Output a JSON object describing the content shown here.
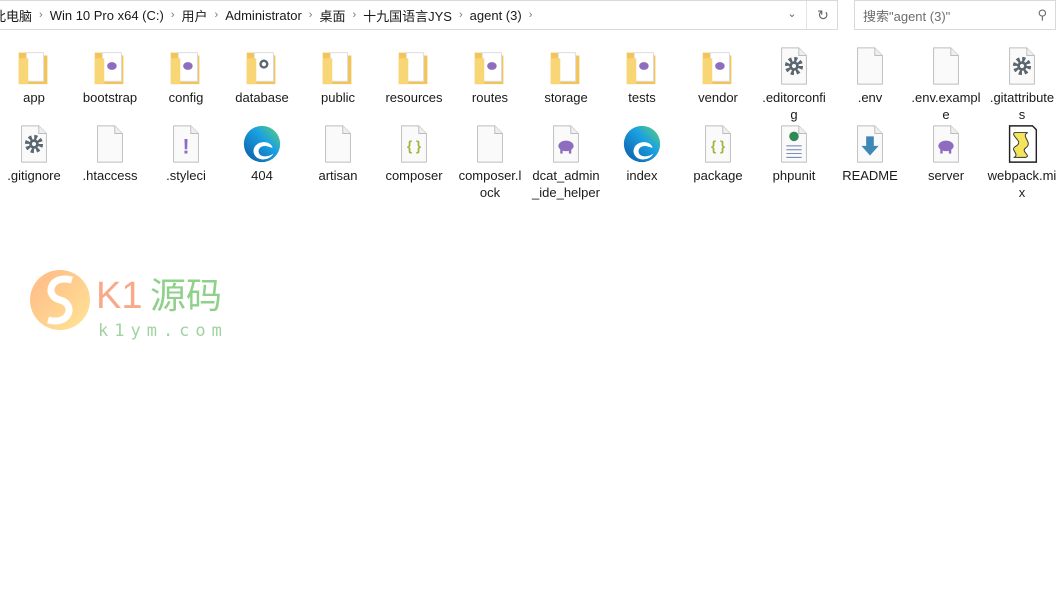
{
  "address_bar": {
    "crumbs": [
      "此电脑",
      "Win 10 Pro x64 (C:)",
      "用户",
      "Administrator",
      "桌面",
      "十九国语言JYS",
      "agent (3)"
    ],
    "dropdown_icon": "chevron-down-icon",
    "refresh_icon": "refresh-icon"
  },
  "search": {
    "placeholder": "搜索\"agent (3)\"",
    "icon": "search-icon"
  },
  "items": [
    {
      "label": "app",
      "icon": "folder"
    },
    {
      "label": "bootstrap",
      "icon": "folder-php"
    },
    {
      "label": "config",
      "icon": "folder-php"
    },
    {
      "label": "database",
      "icon": "folder-gear"
    },
    {
      "label": "public",
      "icon": "folder"
    },
    {
      "label": "resources",
      "icon": "folder"
    },
    {
      "label": "routes",
      "icon": "folder-php"
    },
    {
      "label": "storage",
      "icon": "folder"
    },
    {
      "label": "tests",
      "icon": "folder-php"
    },
    {
      "label": "vendor",
      "icon": "folder-php"
    },
    {
      "label": ".editorconfig",
      "icon": "gear-file"
    },
    {
      "label": ".env",
      "icon": "blank-file"
    },
    {
      "label": ".env.example",
      "icon": "blank-file"
    },
    {
      "label": ".gitattributes",
      "icon": "gear-file"
    },
    {
      "label": ".gitignore",
      "icon": "gear-file"
    },
    {
      "label": ".htaccess",
      "icon": "blank-file"
    },
    {
      "label": ".styleci",
      "icon": "yaml-file"
    },
    {
      "label": "404",
      "icon": "edge"
    },
    {
      "label": "artisan",
      "icon": "blank-file"
    },
    {
      "label": "composer",
      "icon": "json-file"
    },
    {
      "label": "composer.lock",
      "icon": "blank-file"
    },
    {
      "label": "dcat_admin_ide_helper",
      "icon": "php-file"
    },
    {
      "label": "index",
      "icon": "edge"
    },
    {
      "label": "package",
      "icon": "json-file"
    },
    {
      "label": "phpunit",
      "icon": "xml-file"
    },
    {
      "label": "README",
      "icon": "readme-file"
    },
    {
      "label": "server",
      "icon": "php-file"
    },
    {
      "label": "webpack.mix",
      "icon": "script-file"
    }
  ],
  "watermark": {
    "brand": "K1源码",
    "domain": "k1ym.com"
  }
}
